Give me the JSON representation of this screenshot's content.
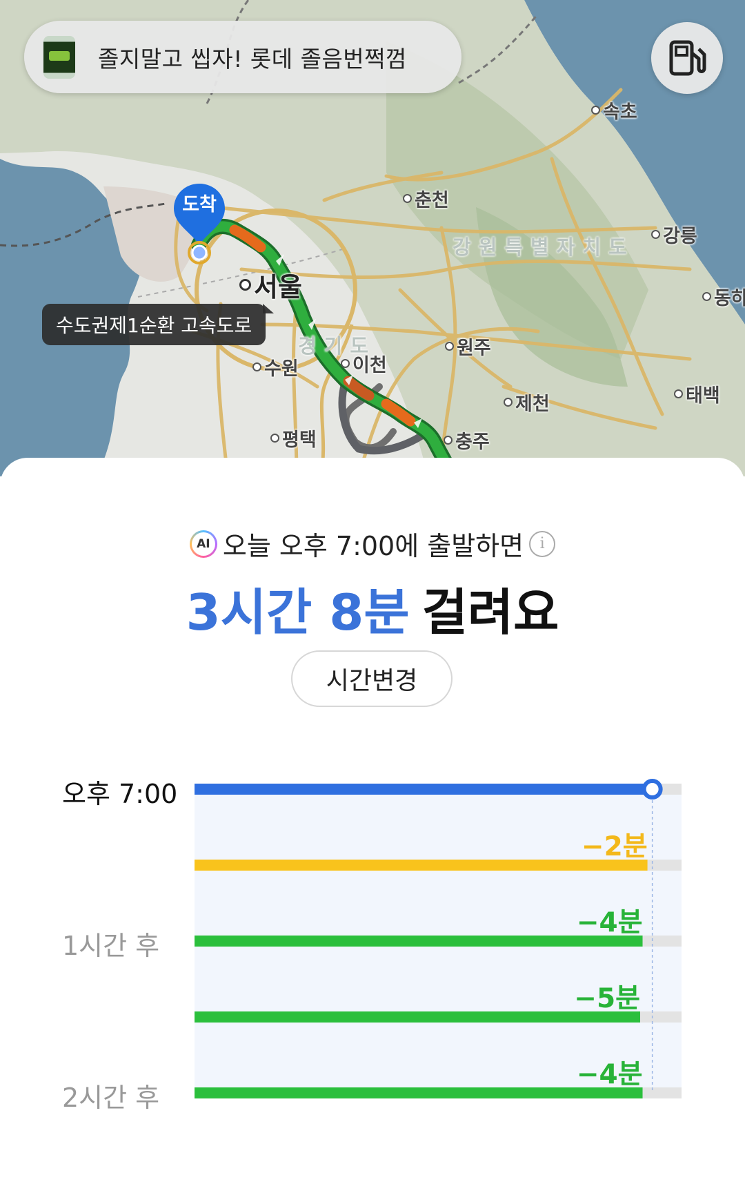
{
  "map": {
    "ad_banner": {
      "text": "졸지말고 씹자! 롯데 졸음번쩍껌"
    },
    "fuel_button": {
      "icon": "gas-station-icon"
    },
    "destination_pin": {
      "label": "도착",
      "color": "#1f6fe0"
    },
    "road_tag": {
      "label": "수도권제1순환 고속도로"
    },
    "cities": [
      {
        "name": "속초"
      },
      {
        "name": "춘천"
      },
      {
        "name": "강릉"
      },
      {
        "name": "서울"
      },
      {
        "name": "동하"
      },
      {
        "name": "원주"
      },
      {
        "name": "수원"
      },
      {
        "name": "이천"
      },
      {
        "name": "제천"
      },
      {
        "name": "태백"
      },
      {
        "name": "평택"
      },
      {
        "name": "충주"
      }
    ],
    "regions": [
      {
        "name": "강원특별자치도"
      },
      {
        "name": "경기도"
      }
    ]
  },
  "summary": {
    "prediction_text": "오늘 오후 7:00에 출발하면",
    "ai_badge": "AI",
    "info_icon": "info-icon",
    "duration": "3시간 8분",
    "duration_suffix": "걸려요",
    "change_time_button": "시간변경",
    "accent": "#3b73d9"
  },
  "chart_data": {
    "type": "bar",
    "orientation": "horizontal",
    "row_labels": [
      "오후 7:00",
      "",
      "1시간 후",
      "",
      "2시간 후"
    ],
    "series": [
      {
        "values": [
          188,
          186,
          184,
          183,
          184
        ],
        "diff_labels": [
          "",
          "−2분",
          "−4분",
          "−5분",
          "−4분"
        ],
        "colors": [
          "#2f6fe0",
          "#f9c31c",
          "#2bbf3c",
          "#2bbf3c",
          "#2bbf3c"
        ]
      }
    ],
    "baseline_minutes": 188,
    "xlim": [
      0,
      200
    ],
    "colors": {
      "track": "#e3e3e3",
      "band": "#f2f6fd",
      "label_selected": "#111111",
      "label_other": "#999999"
    }
  }
}
